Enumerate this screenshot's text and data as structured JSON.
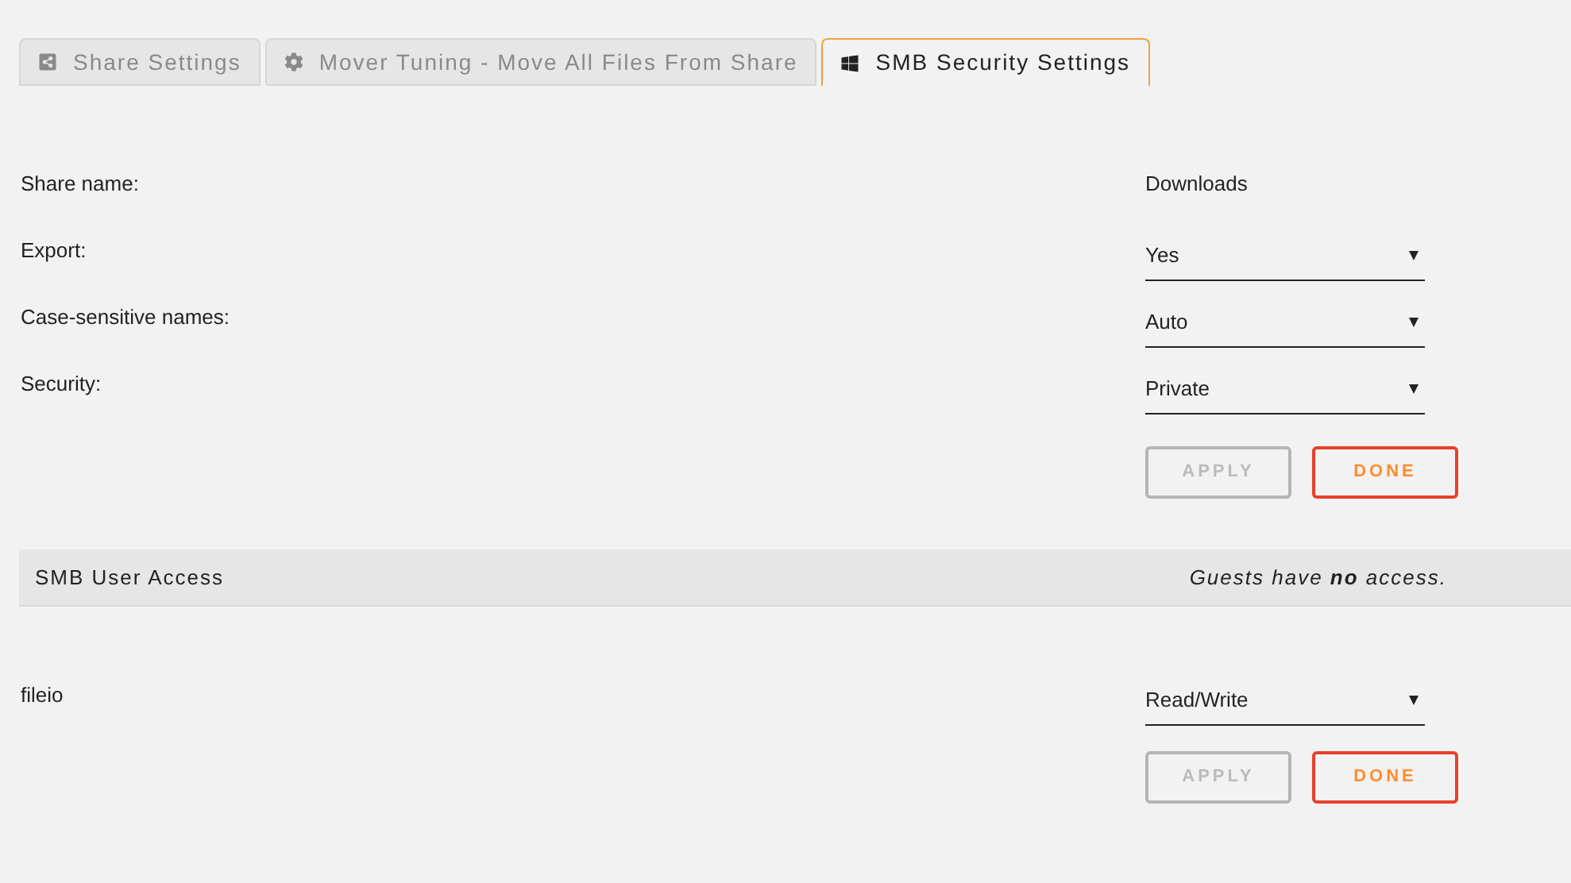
{
  "tabs": [
    {
      "label": "Share Settings",
      "selected": false
    },
    {
      "label": "Mover Tuning - Move All Files From Share",
      "selected": false
    },
    {
      "label": "SMB Security Settings",
      "selected": true
    }
  ],
  "settings": [
    {
      "label": "Share name:",
      "kind": "text",
      "value": "Downloads"
    },
    {
      "label": "Export:",
      "kind": "select",
      "value": "Yes"
    },
    {
      "label": "Case-sensitive names:",
      "kind": "select",
      "value": "Auto"
    },
    {
      "label": "Security:",
      "kind": "select",
      "value": "Private"
    }
  ],
  "settings_buttons": [
    {
      "label": "APPLY",
      "disabled": true
    },
    {
      "label": "DONE",
      "disabled": false
    }
  ],
  "section": {
    "title": "SMB User Access",
    "note": "Guests have **no** access."
  },
  "users": [
    {
      "label": "fileio",
      "kind": "select",
      "value": "Read/Write"
    }
  ],
  "user_buttons": [
    {
      "label": "APPLY",
      "disabled": true
    },
    {
      "label": "DONE",
      "disabled": false
    }
  ]
}
